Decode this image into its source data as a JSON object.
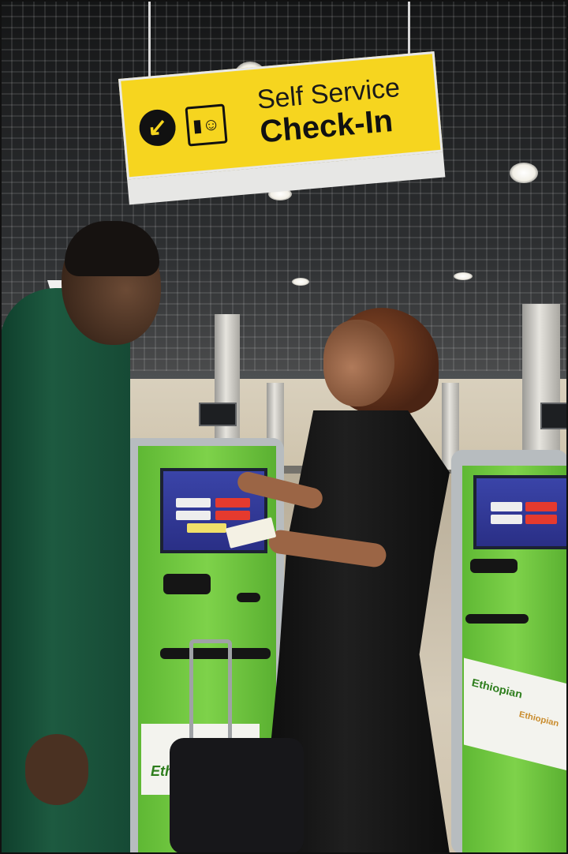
{
  "photo": {
    "description_type": "photograph",
    "colors": {
      "sign_yellow": "#f6d51f",
      "kiosk_green": "#6ec23e",
      "suit_green": "#1d5a40"
    }
  },
  "sign": {
    "line1": "Self Service",
    "line2": "Check-In",
    "arrow_icon": "arrow-down-left-icon",
    "pictogram_icon": "check-in-kiosk-icon"
  },
  "kiosk_left": {
    "brand": "Ethiopian"
  },
  "kiosk_right": {
    "brand": "Ethiopian",
    "brand_secondary": "Ethiopian"
  }
}
